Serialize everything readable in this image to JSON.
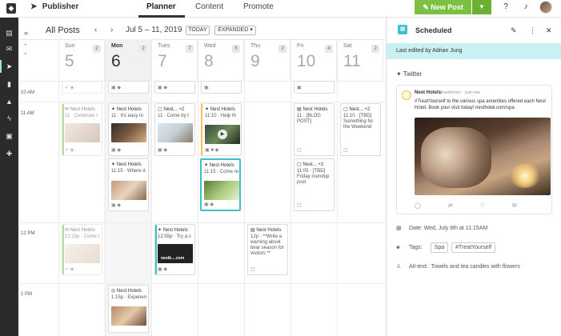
{
  "topbar": {
    "app_name": "Publisher",
    "tabs": [
      "Planner",
      "Content",
      "Promote"
    ],
    "new_post_label": "New Post"
  },
  "calendar": {
    "view_title": "All Posts",
    "date_range": "Jul 5 – 11, 2019",
    "today_btn": "TODAY",
    "expanded_btn": "EXPANDED",
    "days": [
      {
        "name": "Sun",
        "num": "5",
        "count": "2"
      },
      {
        "name": "Mon",
        "num": "6",
        "count": "2"
      },
      {
        "name": "Tues",
        "num": "7",
        "count": "7"
      },
      {
        "name": "Wed",
        "num": "8",
        "count": "5"
      },
      {
        "name": "Thu",
        "num": "9",
        "count": "2"
      },
      {
        "name": "Fri",
        "num": "10",
        "count": "4"
      },
      {
        "name": "Sat",
        "num": "11",
        "count": "2"
      }
    ],
    "times": [
      "10 AM",
      "11 AM",
      "12 PM",
      "1 PM"
    ],
    "cards": {
      "sun1": {
        "head": "Nest Hotels",
        "body": "11 · Celebrate t"
      },
      "sun2": {
        "head": "Nest Hotels",
        "time": "12:15p",
        "body": "Come t"
      },
      "mon1": {
        "head": "Nest Hotels",
        "body": "11 · It's easy to"
      },
      "mon2": {
        "head": "Nest Hotels",
        "time": "11:15",
        "body": "Where d"
      },
      "mon3": {
        "head": "Nest Hotels",
        "time": "1:15p",
        "body": "Experien"
      },
      "tue1": {
        "head": "Nest... +2",
        "body": "11 · Come by t"
      },
      "tue2": {
        "head": "Nest Hotels",
        "time": "12:55p",
        "body": "Try a c",
        "thumb_text": "nesth....com"
      },
      "wed1": {
        "head": "Nest Hotels",
        "time": "11:10",
        "body": "Help th"
      },
      "wed2": {
        "head": "Nest Hotels",
        "time": "11:15",
        "body": "Come re"
      },
      "thu1": {
        "head": "Nest Hotels",
        "time": "12p",
        "body": "**Write a warning about bear season for visitors **"
      },
      "fri1": {
        "head": "Nest Hotels",
        "body": "11 · [BLOG POST]"
      },
      "fri2": {
        "head": "Nest... +2",
        "time": "11:05",
        "body": "[TBD] Friday roundup post"
      },
      "sat1": {
        "head": "Nest... +2",
        "time": "11:10",
        "body": "[TBD] Something for the Weekend"
      }
    }
  },
  "panel": {
    "title": "Scheduled",
    "edited": "Last edited by Adrian Jung",
    "network": "Twitter",
    "tweet": {
      "name": "Nest Hotels",
      "handle": "@nesthotels · Just now",
      "text": "#TreatYourself to the various spa amenities offered each Nest Hotel. Book your visit today! nesthotel.com/spa"
    },
    "date_label": "Date:",
    "date_value": "Wed, July 8th at 11:15AM",
    "tags_label": "Tags:",
    "tags": [
      "Spa",
      "#TreatYourself"
    ],
    "alt_label": "Alt-text:",
    "alt_value": "Towels and tea candles with flowers"
  },
  "colors": {
    "accent": "#3fbfc8",
    "new_post": "#7bc043",
    "edited_bg": "#c9f0f2"
  },
  "icons": [
    "paper-plane-icon",
    "question-icon",
    "bell-icon",
    "chevron-left-icon",
    "chevron-right-icon",
    "pencil-icon",
    "more-icon",
    "close-icon",
    "twitter-icon",
    "calendar-icon",
    "tag-icon",
    "person-icon"
  ]
}
